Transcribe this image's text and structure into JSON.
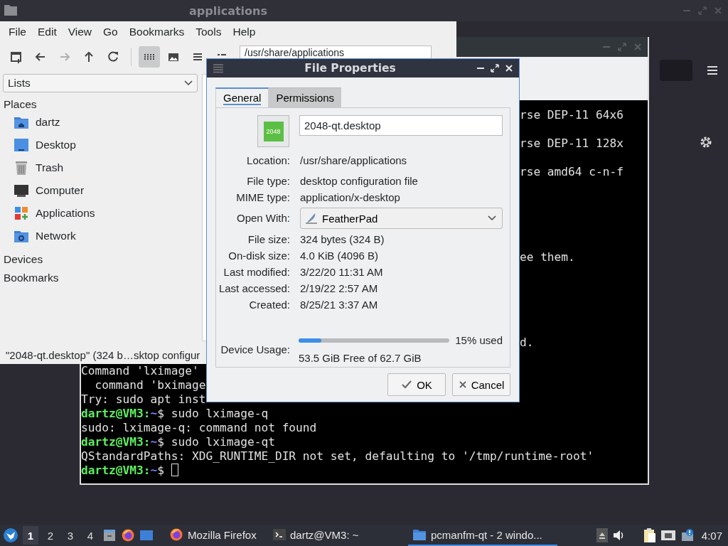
{
  "file_manager": {
    "title": "applications",
    "menu": [
      "File",
      "Edit",
      "View",
      "Go",
      "Bookmarks",
      "Tools",
      "Help"
    ],
    "toolbar": [
      {
        "kind": "new-window",
        "disabled": false,
        "selected": false
      },
      {
        "kind": "back",
        "disabled": false,
        "selected": false
      },
      {
        "kind": "forward",
        "disabled": true,
        "selected": false
      },
      {
        "kind": "up",
        "disabled": false,
        "selected": false
      },
      {
        "kind": "reload",
        "disabled": false,
        "selected": false
      },
      {
        "kind": "icon-view",
        "disabled": false,
        "selected": true
      },
      {
        "kind": "thumbnail-view",
        "disabled": false,
        "selected": false
      },
      {
        "kind": "list-view",
        "disabled": false,
        "selected": false
      },
      {
        "kind": "compact-view",
        "disabled": false,
        "selected": false
      }
    ],
    "path": "/usr/share/applications",
    "sidebar": {
      "dropdown": "Lists",
      "sections": [
        {
          "title": "Places",
          "items": [
            {
              "label": "dartz",
              "kind": "home"
            },
            {
              "label": "Desktop",
              "kind": "desktop"
            },
            {
              "label": "Trash",
              "kind": "trash"
            },
            {
              "label": "Computer",
              "kind": "computer"
            },
            {
              "label": "Applications",
              "kind": "applications"
            },
            {
              "label": "Network",
              "kind": "network"
            }
          ]
        },
        {
          "title": "Devices"
        },
        {
          "title": "Bookmarks"
        }
      ]
    },
    "status": "\"2048-qt.desktop\" (324 b…sktop configur"
  },
  "terminal": {
    "lines": [
      {
        "kind": "tail",
        "text": "rse DEP-11 64x6"
      },
      {
        "kind": "blank"
      },
      {
        "kind": "tail",
        "text": "rse DEP-11 128x"
      },
      {
        "kind": "blank"
      },
      {
        "kind": "tail",
        "text": "rse amd64 c-n-f"
      },
      {
        "kind": "blank"
      },
      {
        "kind": "blank"
      },
      {
        "kind": "blank"
      },
      {
        "kind": "blank"
      },
      {
        "kind": "blank"
      },
      {
        "kind": "tail",
        "text": "ee them."
      },
      {
        "kind": "blank"
      },
      {
        "kind": "blank"
      },
      {
        "kind": "blank"
      },
      {
        "kind": "blank"
      },
      {
        "kind": "blank"
      },
      {
        "kind": "tail",
        "text": "d."
      },
      {
        "kind": "blank"
      },
      {
        "kind": "output",
        "text": "Command 'lximage'"
      },
      {
        "kind": "output",
        "text": "  command 'bximage"
      },
      {
        "kind": "output",
        "text": "Try: sudo apt inst"
      },
      {
        "kind": "prompt",
        "host": "dartz@VM3",
        "sep": ":",
        "path": "~",
        "symbol": "$",
        "command": "sudo lximage-q",
        "cursor": false
      },
      {
        "kind": "output",
        "text": "sudo: lximage-q: command not found"
      },
      {
        "kind": "prompt",
        "host": "dartz@VM3",
        "sep": ":",
        "path": "~",
        "symbol": "$",
        "command": "sudo lximage-qt",
        "cursor": false
      },
      {
        "kind": "output",
        "text": "QStandardPaths: XDG_RUNTIME_DIR not set, defaulting to '/tmp/runtime-root'"
      },
      {
        "kind": "prompt",
        "host": "dartz@VM3",
        "sep": ":",
        "path": "~",
        "symbol": "$",
        "cursor": true
      }
    ]
  },
  "dialog": {
    "title": "File Properties",
    "tabs": [
      {
        "label": "General",
        "selected": true
      },
      {
        "label": "Permissions",
        "selected": false
      }
    ],
    "icon_label": "2048",
    "name": "2048-qt.desktop",
    "fields": [
      {
        "label": "Location:",
        "value": "/usr/share/applications",
        "kind": "text"
      },
      {
        "label": "File type:",
        "value": "desktop configuration file",
        "kind": "text"
      },
      {
        "label": "MIME type:",
        "value": "application/x-desktop",
        "kind": "text"
      },
      {
        "label": "Open With:",
        "value": "FeatherPad",
        "kind": "dropdown"
      },
      {
        "label": "File size:",
        "value": "324 bytes (324 B)",
        "kind": "text"
      },
      {
        "label": "On-disk size:",
        "value": "4.0 KiB (4096 B)",
        "kind": "text"
      },
      {
        "label": "Last modified:",
        "value": "3/22/20 11:31 AM",
        "kind": "text"
      },
      {
        "label": "Last accessed:",
        "value": "2/19/22 2:57 AM",
        "kind": "text"
      },
      {
        "label": "Created:",
        "value": "8/25/21 3:37 AM",
        "kind": "text"
      }
    ],
    "device_usage": {
      "label": "Device Usage:",
      "level": 0.15,
      "reading": "15% used",
      "free": "53.5 GiB Free of 62.7 GiB"
    },
    "buttons": [
      {
        "label": "OK",
        "kind": "ok"
      },
      {
        "label": "Cancel",
        "kind": "cancel"
      }
    ]
  },
  "taskbar": {
    "workspaces": [
      {
        "label": "1",
        "selected": true
      },
      {
        "label": "2",
        "selected": false
      },
      {
        "label": "3",
        "selected": false
      },
      {
        "label": "4",
        "selected": false
      }
    ],
    "launchers": [
      {
        "kind": "files"
      },
      {
        "kind": "firefox"
      },
      {
        "kind": "desktop"
      }
    ],
    "tasks": [
      {
        "label": "Mozilla Firefox",
        "kind": "firefox",
        "selected": false
      },
      {
        "label": "dartz@VM3: ~",
        "kind": "terminal",
        "selected": false
      },
      {
        "label": "pcmanfm-qt - 2 windo...",
        "kind": "folder",
        "selected": true
      }
    ],
    "tray": [
      {
        "kind": "up"
      },
      {
        "kind": "volume"
      },
      {
        "kind": "clipboard"
      },
      {
        "kind": "network"
      },
      {
        "kind": "notification"
      }
    ],
    "clock": "4:07"
  }
}
